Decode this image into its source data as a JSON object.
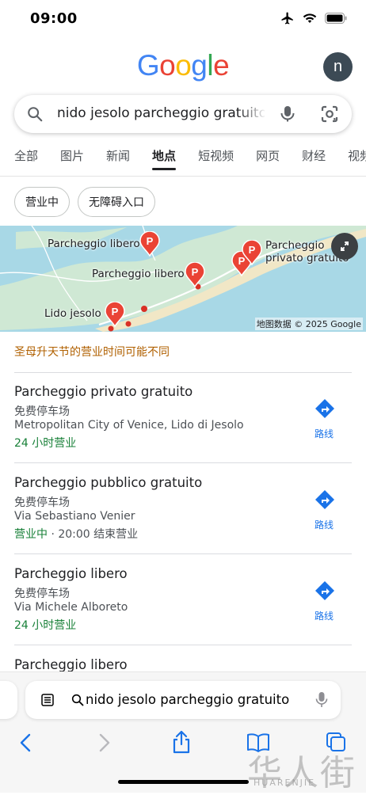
{
  "status": {
    "time": "09:00"
  },
  "header": {
    "logo_letters": [
      "G",
      "o",
      "o",
      "g",
      "l",
      "e"
    ],
    "logo_colors": [
      "#4285F4",
      "#EA4335",
      "#FBBC05",
      "#4285F4",
      "#34A853",
      "#EA4335"
    ],
    "avatar_letter": "n"
  },
  "search": {
    "query": "nido jesolo parcheggio gratuito"
  },
  "tabs": [
    "全部",
    "图片",
    "新闻",
    "地点",
    "短视频",
    "网页",
    "财经",
    "视频"
  ],
  "chips": [
    "营业中",
    "无障碍入口"
  ],
  "map": {
    "labels": [
      "Parcheggio libero",
      "Parcheggio libero",
      "Lido jesolo",
      "Parcheggio",
      "privato gratuito"
    ],
    "attribution": "地图数据 © 2025 Google"
  },
  "notice": "圣母升天节的营业时间可能不同",
  "results": [
    {
      "title": "Parcheggio privato gratuito",
      "type": "免费停车场",
      "address": "Metropolitan City of Venice, Lido di Jesolo",
      "hours_status": "24 小时营业",
      "hours_detail": "",
      "directions": "路线"
    },
    {
      "title": "Parcheggio pubblico gratuito",
      "type": "免费停车场",
      "address": "Via Sebastiano Venier",
      "hours_status": "营业中",
      "hours_detail": " · 20:00 结束营业",
      "directions": "路线"
    },
    {
      "title": "Parcheggio libero",
      "type": "免费停车场",
      "address": "Via Michele Alboreto",
      "hours_status": "24 小时营业",
      "hours_detail": "",
      "directions": "路线"
    },
    {
      "title": "Parcheggio libero"
    }
  ],
  "browser": {
    "address": "nido jesolo parcheggio gratuito"
  },
  "watermark": {
    "main": "华人街",
    "sub": "HUARENJIE"
  },
  "colors": {
    "accent_blue": "#1a73e8",
    "open_green": "#188038",
    "notice_orange": "#b06000",
    "pin_red": "#ea4335"
  }
}
